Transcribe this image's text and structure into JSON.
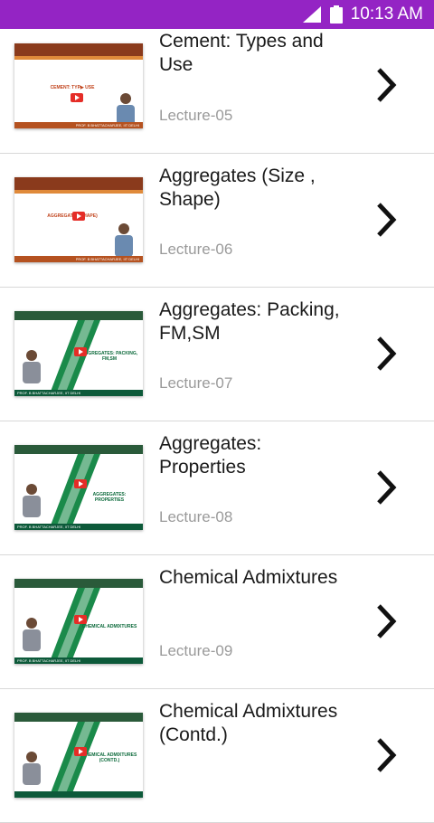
{
  "status": {
    "time": "10:13 AM",
    "icons": [
      "signal-icon",
      "battery-icon"
    ]
  },
  "lectures": [
    {
      "title_line1": "Cement: Types and",
      "title_line2": "Use",
      "lecture": "Lecture-05",
      "thumb_label": "CEMENT: TYP▶ USE"
    },
    {
      "title_line1": "Aggregates (Size ,",
      "title_line2": "Shape)",
      "lecture": "Lecture-06",
      "thumb_label": "AGGREGATES SHAPE)"
    },
    {
      "title_line1": "Aggregates: Packing,",
      "title_line2": "FM,SM",
      "lecture": "Lecture-07",
      "thumb_label": "AGGREGATES: PACKING, FM,SM"
    },
    {
      "title_line1": "Aggregates:",
      "title_line2": "Properties",
      "lecture": "Lecture-08",
      "thumb_label": "AGGREGATES: PROPERTIES"
    },
    {
      "title_line1": "Chemical Admixtures",
      "title_line2": "",
      "lecture": "Lecture-09",
      "thumb_label": "CHEMICAL ADMIXTURES"
    },
    {
      "title_line1": "Chemical Admixtures",
      "title_line2": "(Contd.)",
      "lecture": "",
      "thumb_label": "CHEMICAL ADMIXTURES (CONTD.)"
    }
  ],
  "thumb_footer": "PROF. B BHATTACHARJEE, IIT DELHI"
}
